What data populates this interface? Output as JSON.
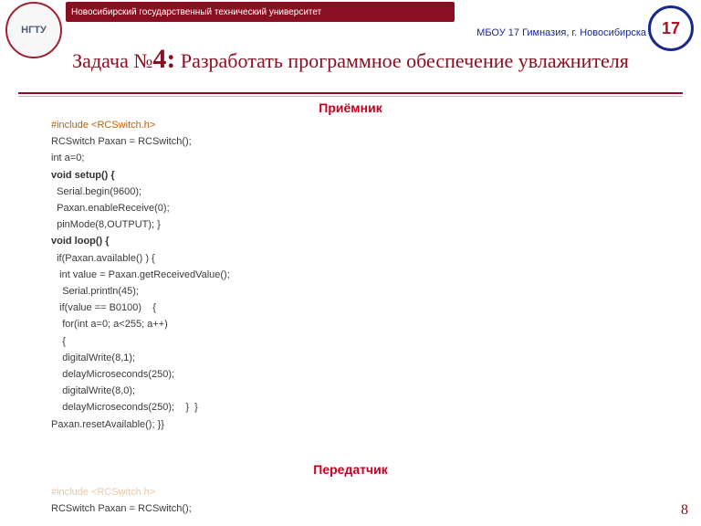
{
  "header": {
    "university": "Новосибирский государственный технический университет",
    "school": "МБОУ 17 Гимназия, г. Новосибирска",
    "logo1_text": "НГТУ",
    "logo2_text": "17"
  },
  "title": {
    "prefix": "Задача №",
    "num": "4:",
    "rest": " Разработать программное обеспечение увлажнителя"
  },
  "sections": {
    "receiver": "Приёмник",
    "transmitter": "Передатчик"
  },
  "code1": {
    "l0": "#include <RCSwitch.h>",
    "l1": "RCSwitch Paxan = RCSwitch();",
    "l2": "int a=0;",
    "l3": "void setup() {",
    "l4": "  Serial.begin(9600);",
    "l5": "  Paxan.enableReceive(0);",
    "l6": "  pinMode(8,OUTPUT); }",
    "l7": "void loop() {",
    "l8": "  if(Paxan.available() ) {",
    "l9": "   int value = Paxan.getReceivedValue();",
    "l10": "    Serial.println(45);",
    "l11": "   if(value == B0100)    {",
    "l12": "    for(int a=0; a<255; a++)",
    "l13": "    {",
    "l14": "    digitalWrite(8,1);",
    "l15": "    delayMicroseconds(250);",
    "l16": "    digitalWrite(8,0);",
    "l17": "    delayMicroseconds(250);    }  }",
    "l18": "Paxan.resetAvailable(); }}"
  },
  "code2": {
    "l0": "#include <RCSwitch.h>",
    "l1": "RCSwitch Paxan = RCSwitch();"
  },
  "page": "8"
}
